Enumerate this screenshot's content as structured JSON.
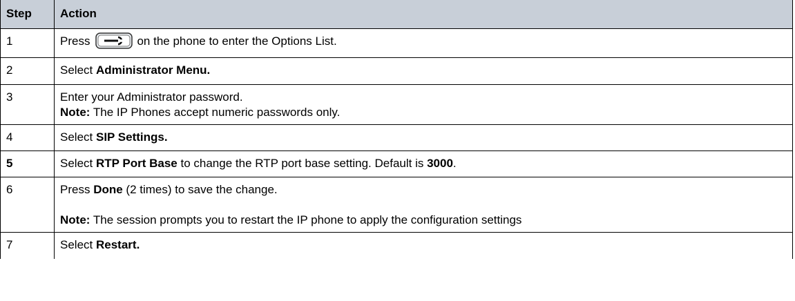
{
  "table": {
    "headers": {
      "step": "Step",
      "action": "Action"
    },
    "rows": [
      {
        "step": "1",
        "before": "Press",
        "icon": "options-key-icon",
        "after": "on the phone to enter the Options List."
      },
      {
        "step": "2",
        "prefix": "Select ",
        "bold": "Administrator Menu."
      },
      {
        "step": "3",
        "line1": "Enter your Administrator password.",
        "note_label": "Note:",
        "note_text": " The IP Phones accept numeric passwords only."
      },
      {
        "step": "4",
        "prefix": "Select ",
        "bold": "SIP Settings."
      },
      {
        "step": "5",
        "prefix": "Select ",
        "bold": "RTP Port Base",
        "middle": " to change the RTP port base setting. Default is ",
        "bold2": "3000",
        "suffix": "."
      },
      {
        "step": "6",
        "prefix": "Press ",
        "bold": "Done",
        "suffix": " (2 times) to save the change.",
        "note_label": "Note:",
        "note_text": " The session prompts you to restart the IP phone to apply the configuration settings"
      },
      {
        "step": "7",
        "prefix": "Select ",
        "bold": "Restart."
      }
    ]
  },
  "colors": {
    "header_background": "#c8cfd8",
    "border": "#000000"
  }
}
